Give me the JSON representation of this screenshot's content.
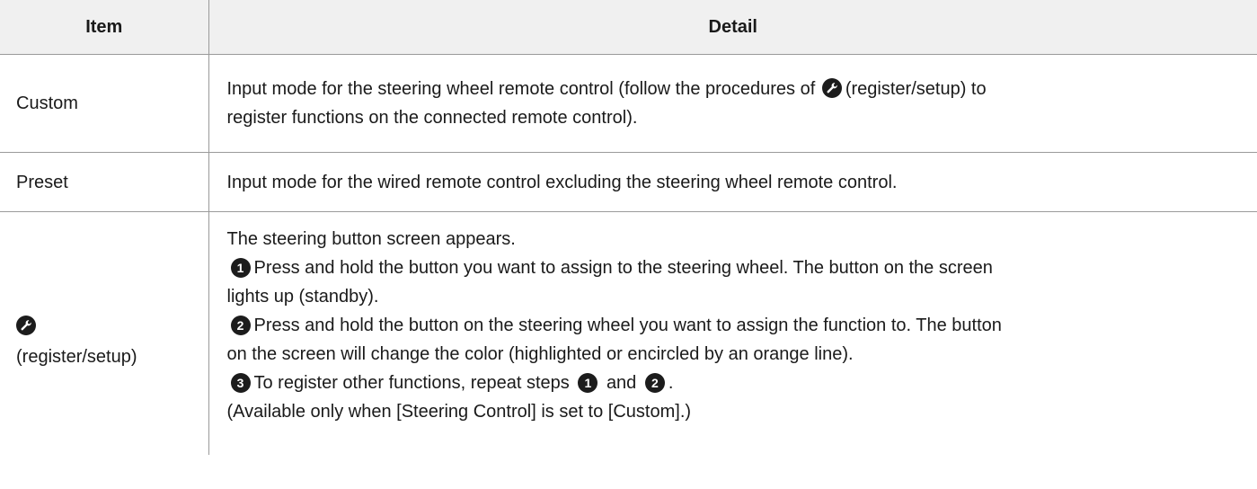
{
  "header": {
    "item": "Item",
    "detail": "Detail"
  },
  "rows": [
    {
      "item": "Custom",
      "detail_before_icon": "Input mode for the steering wheel remote control (follow the procedures of",
      "detail_after_icon": "(register/setup) to",
      "detail_line2": "register functions on the connected remote control)."
    },
    {
      "item": "Preset",
      "detail": "Input mode for the wired remote control excluding the steering wheel remote control."
    },
    {
      "item": "(register/setup)",
      "intro": "The steering button screen appears.",
      "step1_num": "1",
      "step1_line1": "Press and hold the button you want to assign to the steering wheel. The button on the screen",
      "step1_line2": "lights up (standby).",
      "step2_num": "2",
      "step2_line1": "Press and hold the button on the steering wheel you want to assign the function to. The button",
      "step2_line2": "on the screen will change the color (highlighted or encircled by an orange line).",
      "step3_num": "3",
      "step3_text": "To register other functions, repeat steps",
      "step3_ref1": "1",
      "step3_and": "and",
      "step3_ref2": "2",
      "step3_end": ".",
      "note": "(Available only when [Steering Control] is set to [Custom].)"
    }
  ],
  "icons": {
    "wrench": "wrench-icon"
  },
  "colors": {
    "header_bg": "#f0f0f0",
    "border": "#9a9a9a",
    "text": "#1a1a1a",
    "step_bg": "#1c1c1c"
  }
}
